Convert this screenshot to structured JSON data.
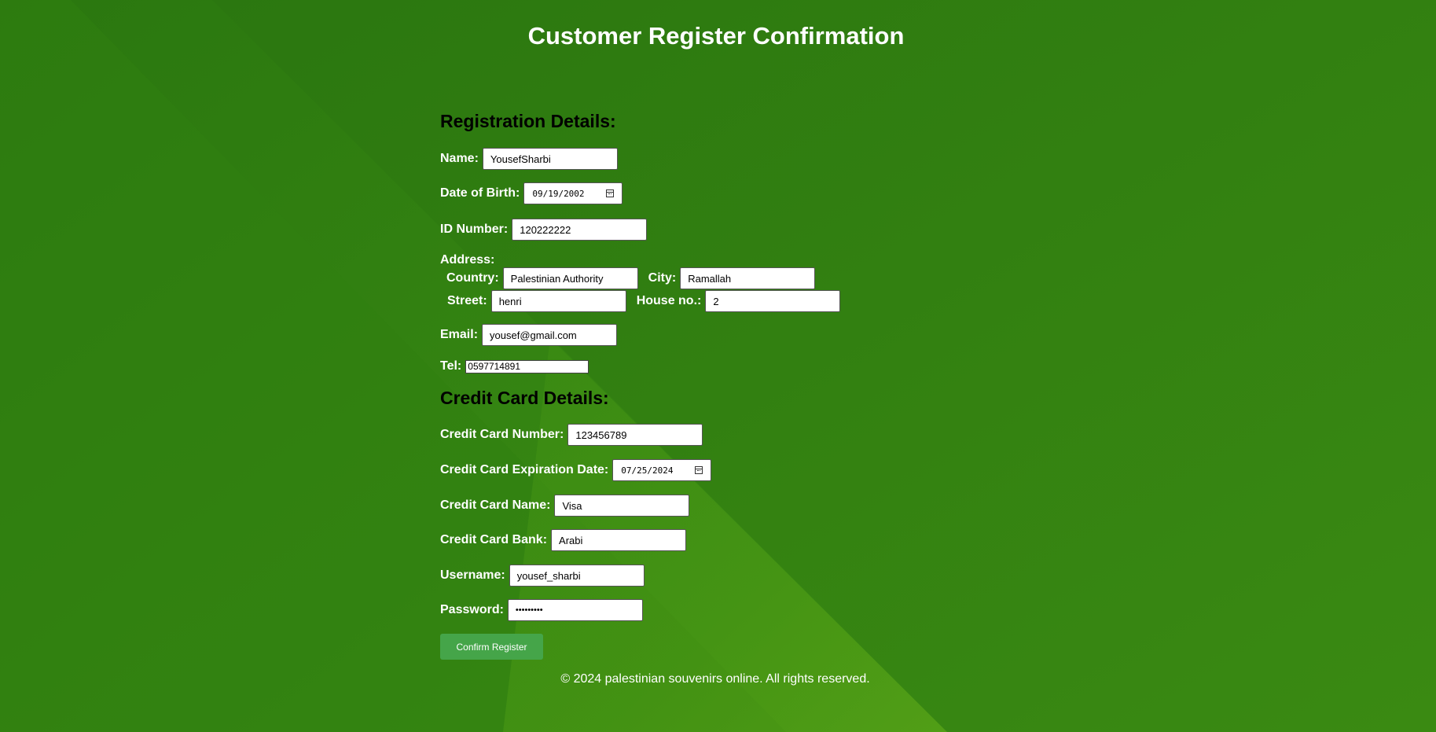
{
  "page": {
    "title": "Customer Register Confirmation"
  },
  "registration": {
    "heading": "Registration Details:",
    "name": {
      "label": "Name:",
      "value": "YousefSharbi"
    },
    "dob": {
      "label": "Date of Birth:",
      "value": "09/19/2002"
    },
    "id_number": {
      "label": "ID Number:",
      "value": "120222222"
    },
    "address": {
      "label": "Address:",
      "country": {
        "label": "Country:",
        "value": "Palestinian Authority"
      },
      "city": {
        "label": "City:",
        "value": "Ramallah"
      },
      "street": {
        "label": "Street:",
        "value": "henri"
      },
      "house_no": {
        "label": "House no.:",
        "value": "2"
      }
    },
    "email": {
      "label": "Email:",
      "value": "yousef@gmail.com"
    },
    "tel": {
      "label": "Tel:",
      "value": "0597714891"
    }
  },
  "credit_card": {
    "heading": "Credit Card Details:",
    "number": {
      "label": "Credit Card Number:",
      "value": "123456789"
    },
    "expiration": {
      "label": "Credit Card Expiration Date:",
      "value": "07/25/2024"
    },
    "name": {
      "label": "Credit Card Name:",
      "value": "Visa"
    },
    "bank": {
      "label": "Credit Card Bank:",
      "value": "Arabi"
    },
    "username": {
      "label": "Username:",
      "value": "yousef_sharbi"
    },
    "password": {
      "label": "Password:",
      "value": "•••••••••"
    }
  },
  "actions": {
    "confirm_label": "Confirm Register"
  },
  "footer": {
    "text": "© 2024 palestinian souvenirs online. All rights reserved."
  },
  "colors": {
    "background": "#2e7d10",
    "accent_light": "#5ba616",
    "button": "#45a549"
  },
  "icons": {
    "date_picker": "calendar-icon"
  }
}
